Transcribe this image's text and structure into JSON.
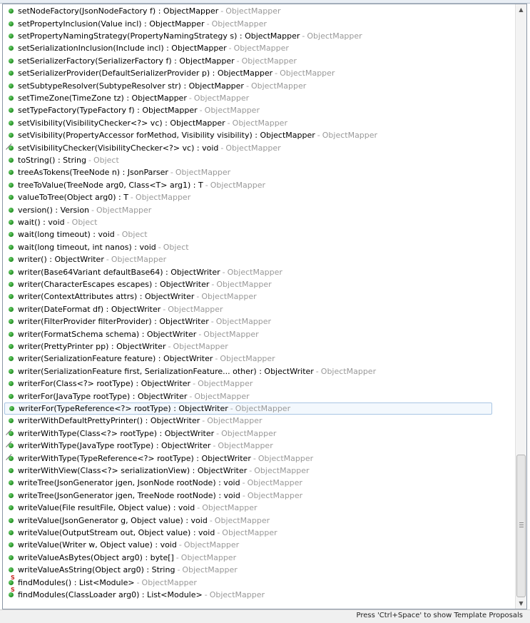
{
  "proposals": [
    {
      "sig": "setNodeFactory(JsonNodeFactory f) : ObjectMapper",
      "owner": "ObjectMapper",
      "icon": "public-method-icon"
    },
    {
      "sig": "setPropertyInclusion(Value incl) : ObjectMapper",
      "owner": "ObjectMapper",
      "icon": "public-method-icon"
    },
    {
      "sig": "setPropertyNamingStrategy(PropertyNamingStrategy s) : ObjectMapper",
      "owner": "ObjectMapper",
      "icon": "public-method-icon"
    },
    {
      "sig": "setSerializationInclusion(Include incl) : ObjectMapper",
      "owner": "ObjectMapper",
      "icon": "public-method-icon"
    },
    {
      "sig": "setSerializerFactory(SerializerFactory f) : ObjectMapper",
      "owner": "ObjectMapper",
      "icon": "public-method-icon"
    },
    {
      "sig": "setSerializerProvider(DefaultSerializerProvider p) : ObjectMapper",
      "owner": "ObjectMapper",
      "icon": "public-method-icon"
    },
    {
      "sig": "setSubtypeResolver(SubtypeResolver str) : ObjectMapper",
      "owner": "ObjectMapper",
      "icon": "public-method-icon"
    },
    {
      "sig": "setTimeZone(TimeZone tz) : ObjectMapper",
      "owner": "ObjectMapper",
      "icon": "public-method-icon"
    },
    {
      "sig": "setTypeFactory(TypeFactory f) : ObjectMapper",
      "owner": "ObjectMapper",
      "icon": "public-method-icon"
    },
    {
      "sig": "setVisibility(VisibilityChecker<?> vc) : ObjectMapper",
      "owner": "ObjectMapper",
      "icon": "public-method-icon"
    },
    {
      "sig": "setVisibility(PropertyAccessor forMethod, Visibility visibility) : ObjectMapper",
      "owner": "ObjectMapper",
      "icon": "public-method-icon"
    },
    {
      "sig": "setVisibilityChecker(VisibilityChecker<?> vc) : void",
      "owner": "ObjectMapper",
      "icon": "deprecated-method-icon"
    },
    {
      "sig": "toString() : String",
      "owner": "Object",
      "icon": "public-method-icon"
    },
    {
      "sig": "treeAsTokens(TreeNode n) : JsonParser",
      "owner": "ObjectMapper",
      "icon": "public-method-icon"
    },
    {
      "sig": "treeToValue(TreeNode arg0, Class<T> arg1) : T",
      "owner": "ObjectMapper",
      "icon": "public-method-icon"
    },
    {
      "sig": "valueToTree(Object arg0) : T",
      "owner": "ObjectMapper",
      "icon": "public-method-icon"
    },
    {
      "sig": "version() : Version",
      "owner": "ObjectMapper",
      "icon": "public-method-icon"
    },
    {
      "sig": "wait() : void",
      "owner": "Object",
      "icon": "public-method-icon"
    },
    {
      "sig": "wait(long timeout) : void",
      "owner": "Object",
      "icon": "public-method-icon"
    },
    {
      "sig": "wait(long timeout, int nanos) : void",
      "owner": "Object",
      "icon": "public-method-icon"
    },
    {
      "sig": "writer() : ObjectWriter",
      "owner": "ObjectMapper",
      "icon": "public-method-icon"
    },
    {
      "sig": "writer(Base64Variant defaultBase64) : ObjectWriter",
      "owner": "ObjectMapper",
      "icon": "public-method-icon"
    },
    {
      "sig": "writer(CharacterEscapes escapes) : ObjectWriter",
      "owner": "ObjectMapper",
      "icon": "public-method-icon"
    },
    {
      "sig": "writer(ContextAttributes attrs) : ObjectWriter",
      "owner": "ObjectMapper",
      "icon": "public-method-icon"
    },
    {
      "sig": "writer(DateFormat df) : ObjectWriter",
      "owner": "ObjectMapper",
      "icon": "public-method-icon"
    },
    {
      "sig": "writer(FilterProvider filterProvider) : ObjectWriter",
      "owner": "ObjectMapper",
      "icon": "public-method-icon"
    },
    {
      "sig": "writer(FormatSchema schema) : ObjectWriter",
      "owner": "ObjectMapper",
      "icon": "public-method-icon"
    },
    {
      "sig": "writer(PrettyPrinter pp) : ObjectWriter",
      "owner": "ObjectMapper",
      "icon": "public-method-icon"
    },
    {
      "sig": "writer(SerializationFeature feature) : ObjectWriter",
      "owner": "ObjectMapper",
      "icon": "public-method-icon"
    },
    {
      "sig": "writer(SerializationFeature first, SerializationFeature... other) : ObjectWriter",
      "owner": "ObjectMapper",
      "icon": "public-method-icon"
    },
    {
      "sig": "writerFor(Class<?> rootType) : ObjectWriter",
      "owner": "ObjectMapper",
      "icon": "public-method-icon"
    },
    {
      "sig": "writerFor(JavaType rootType) : ObjectWriter",
      "owner": "ObjectMapper",
      "icon": "public-method-icon"
    },
    {
      "sig": "writerFor(TypeReference<?> rootType) : ObjectWriter",
      "owner": "ObjectMapper",
      "icon": "public-method-icon",
      "selected": true
    },
    {
      "sig": "writerWithDefaultPrettyPrinter() : ObjectWriter",
      "owner": "ObjectMapper",
      "icon": "public-method-icon"
    },
    {
      "sig": "writerWithType(Class<?> rootType) : ObjectWriter",
      "owner": "ObjectMapper",
      "icon": "deprecated-method-icon"
    },
    {
      "sig": "writerWithType(JavaType rootType) : ObjectWriter",
      "owner": "ObjectMapper",
      "icon": "deprecated-method-icon"
    },
    {
      "sig": "writerWithType(TypeReference<?> rootType) : ObjectWriter",
      "owner": "ObjectMapper",
      "icon": "deprecated-method-icon"
    },
    {
      "sig": "writerWithView(Class<?> serializationView) : ObjectWriter",
      "owner": "ObjectMapper",
      "icon": "public-method-icon"
    },
    {
      "sig": "writeTree(JsonGenerator jgen, JsonNode rootNode) : void",
      "owner": "ObjectMapper",
      "icon": "public-method-icon"
    },
    {
      "sig": "writeTree(JsonGenerator jgen, TreeNode rootNode) : void",
      "owner": "ObjectMapper",
      "icon": "public-method-icon"
    },
    {
      "sig": "writeValue(File resultFile, Object value) : void",
      "owner": "ObjectMapper",
      "icon": "public-method-icon"
    },
    {
      "sig": "writeValue(JsonGenerator g, Object value) : void",
      "owner": "ObjectMapper",
      "icon": "public-method-icon"
    },
    {
      "sig": "writeValue(OutputStream out, Object value) : void",
      "owner": "ObjectMapper",
      "icon": "public-method-icon"
    },
    {
      "sig": "writeValue(Writer w, Object value) : void",
      "owner": "ObjectMapper",
      "icon": "public-method-icon"
    },
    {
      "sig": "writeValueAsBytes(Object arg0) : byte[]",
      "owner": "ObjectMapper",
      "icon": "public-method-icon"
    },
    {
      "sig": "writeValueAsString(Object arg0) : String",
      "owner": "ObjectMapper",
      "icon": "public-method-icon"
    },
    {
      "sig": "findModules() : List<Module>",
      "owner": "ObjectMapper",
      "icon": "static-method-icon"
    },
    {
      "sig": "findModules(ClassLoader arg0) : List<Module>",
      "owner": "ObjectMapper",
      "icon": "static-method-icon"
    }
  ],
  "separator": "-",
  "static_marker": "S",
  "status_hint": "Press 'Ctrl+Space' to show Template Proposals",
  "colors": {
    "method_green": "#2e9a2e",
    "owner_gray": "#999999",
    "selection_border": "#a9c6e4",
    "selection_fill": "#f3f8fd",
    "static_red": "#c8251f"
  },
  "scrollbar": {
    "position_fraction": 0.95
  }
}
